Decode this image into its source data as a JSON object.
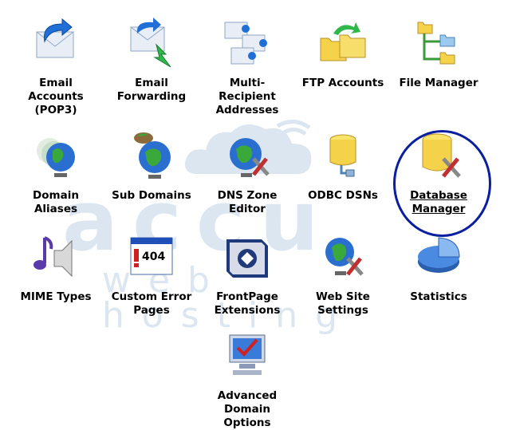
{
  "items": [
    {
      "label": "Email\nAccounts\n(POP3)"
    },
    {
      "label": "Email\nForwarding"
    },
    {
      "label": "Multi-\nRecipient\nAddresses"
    },
    {
      "label": "FTP Accounts"
    },
    {
      "label": "File Manager"
    },
    {
      "label": "Domain\nAliases"
    },
    {
      "label": "Sub Domains"
    },
    {
      "label": "DNS Zone\nEditor"
    },
    {
      "label": "ODBC DSNs"
    },
    {
      "label": "Database\nManager"
    },
    {
      "label": "MIME Types"
    },
    {
      "label": "Custom Error\nPages"
    },
    {
      "label": "FrontPage\nExtensions"
    },
    {
      "label": "Web Site\nSettings"
    },
    {
      "label": "Statistics"
    },
    {
      "label": "Advanced\nDomain\nOptions"
    }
  ],
  "watermark": {
    "line1": "accu",
    "line2": "web hosting"
  },
  "error_badge": "404",
  "colors": {
    "highlight": "#0a1fa0",
    "watermark": "#dbe6f0"
  }
}
